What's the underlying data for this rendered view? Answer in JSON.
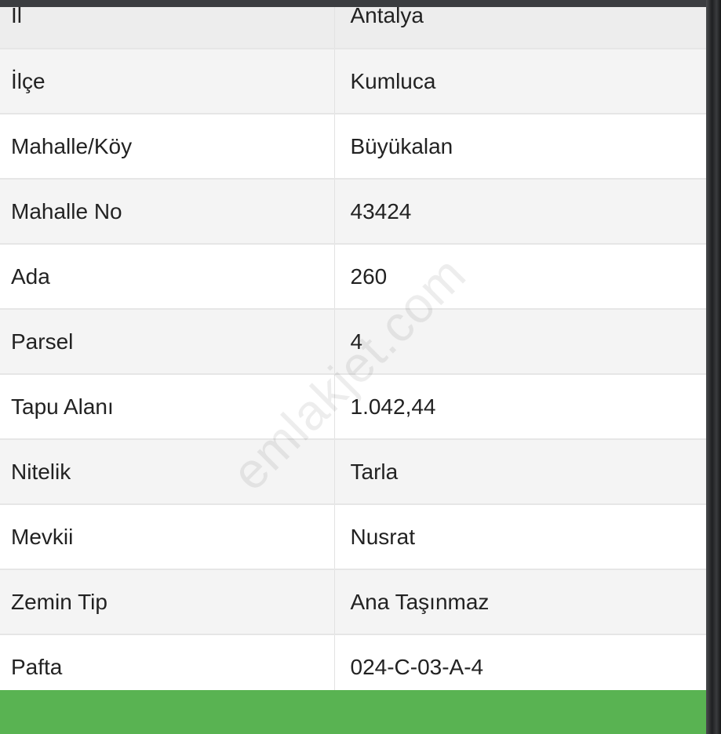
{
  "rows": [
    {
      "label": "İl",
      "value": "Antalya"
    },
    {
      "label": "İlçe",
      "value": "Kumluca"
    },
    {
      "label": "Mahalle/Köy",
      "value": "Büyükalan"
    },
    {
      "label": "Mahalle No",
      "value": "43424"
    },
    {
      "label": "Ada",
      "value": "260"
    },
    {
      "label": "Parsel",
      "value": "4"
    },
    {
      "label": "Tapu Alanı",
      "value": "1.042,44"
    },
    {
      "label": "Nitelik",
      "value": "Tarla"
    },
    {
      "label": "Mevkii",
      "value": "Nusrat"
    },
    {
      "label": "Zemin Tip",
      "value": "Ana Taşınmaz"
    },
    {
      "label": "Pafta",
      "value": "024-C-03-A-4"
    }
  ],
  "watermark": "emlakjet.com",
  "colors": {
    "footer_button": "#59b352"
  }
}
